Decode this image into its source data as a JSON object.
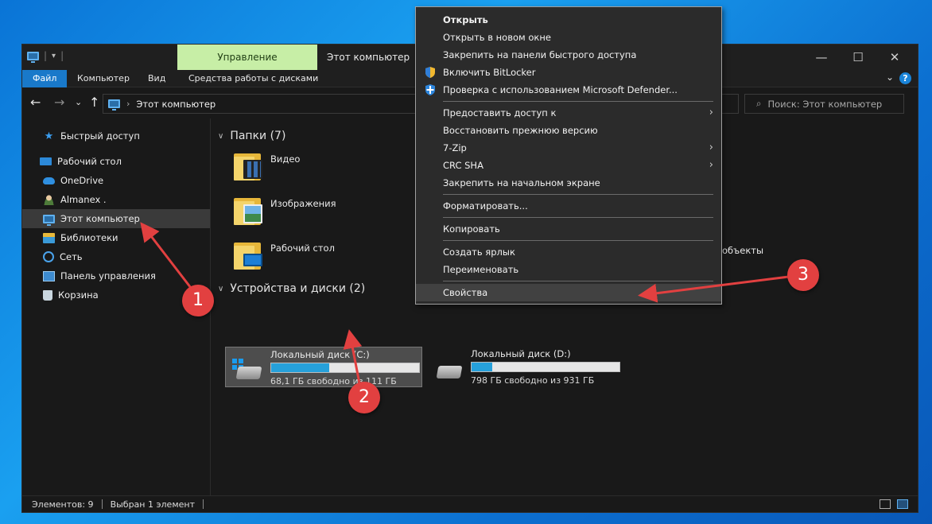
{
  "window": {
    "context_tab": "Управление",
    "title": "Этот компьютер",
    "minimize": "—",
    "maximize": "☐",
    "close": "✕"
  },
  "ribbon": {
    "tabs": [
      "Файл",
      "Компьютер",
      "Вид",
      "Средства работы с дисками"
    ],
    "collapse": "⌄",
    "help": "?"
  },
  "address": {
    "back": "←",
    "forward": "→",
    "recent": "⌄",
    "up": "↑",
    "path": "Этот компьютер",
    "search_placeholder": "Поиск: Этот компьютер"
  },
  "nav_pane": {
    "items": [
      {
        "label": "Быстрый доступ",
        "icon": "star-icon"
      },
      {
        "label": "Рабочий стол",
        "icon": "desktop-icon"
      },
      {
        "label": "OneDrive",
        "icon": "cloud-icon"
      },
      {
        "label": "Almanex .",
        "icon": "user-icon"
      },
      {
        "label": "Этот компьютер",
        "icon": "computer-icon",
        "selected": true
      },
      {
        "label": "Библиотеки",
        "icon": "library-icon"
      },
      {
        "label": "Сеть",
        "icon": "network-icon"
      },
      {
        "label": "Панель управления",
        "icon": "control-panel-icon"
      },
      {
        "label": "Корзина",
        "icon": "recycle-bin-icon"
      }
    ]
  },
  "content": {
    "folders_header": "Папки (7)",
    "folders": [
      {
        "label": "Видео",
        "icon": "video-folder-icon"
      },
      {
        "label": "Изображения",
        "icon": "pictures-folder-icon"
      },
      {
        "label": "Рабочий стол",
        "icon": "desktop-folder-icon"
      }
    ],
    "objects_label": "объекты",
    "devices_header": "Устройства и диски (2)",
    "drives": [
      {
        "name": "Локальный диск (C:)",
        "free": "68,1 ГБ свободно из 111 ГБ",
        "used_fraction": 0.39,
        "selected": true
      },
      {
        "name": "Локальный диск (D:)",
        "free": "798 ГБ свободно из 931 ГБ",
        "used_fraction": 0.14,
        "selected": false
      }
    ]
  },
  "status": {
    "items": "Элементов: 9",
    "selected": "Выбран 1 элемент"
  },
  "context_menu": {
    "items": [
      "Открыть",
      "Открыть в новом окне",
      "Закрепить на панели быстрого доступа",
      "Включить BitLocker",
      "Проверка с использованием Microsoft Defender...",
      "Предоставить доступ к",
      "Восстановить прежнюю версию",
      "7-Zip",
      "CRC SHA",
      "Закрепить на начальном экране",
      "Форматировать...",
      "Копировать",
      "Создать ярлык",
      "Переименовать",
      "Свойства"
    ],
    "submenu_arrow": "›"
  },
  "annotations": {
    "badges": [
      "1",
      "2",
      "3"
    ],
    "color": "#e24040"
  },
  "colors": {
    "accent": "#1979ca",
    "context_tab": "#c7eea6",
    "drive_bar": "#26a0da"
  }
}
